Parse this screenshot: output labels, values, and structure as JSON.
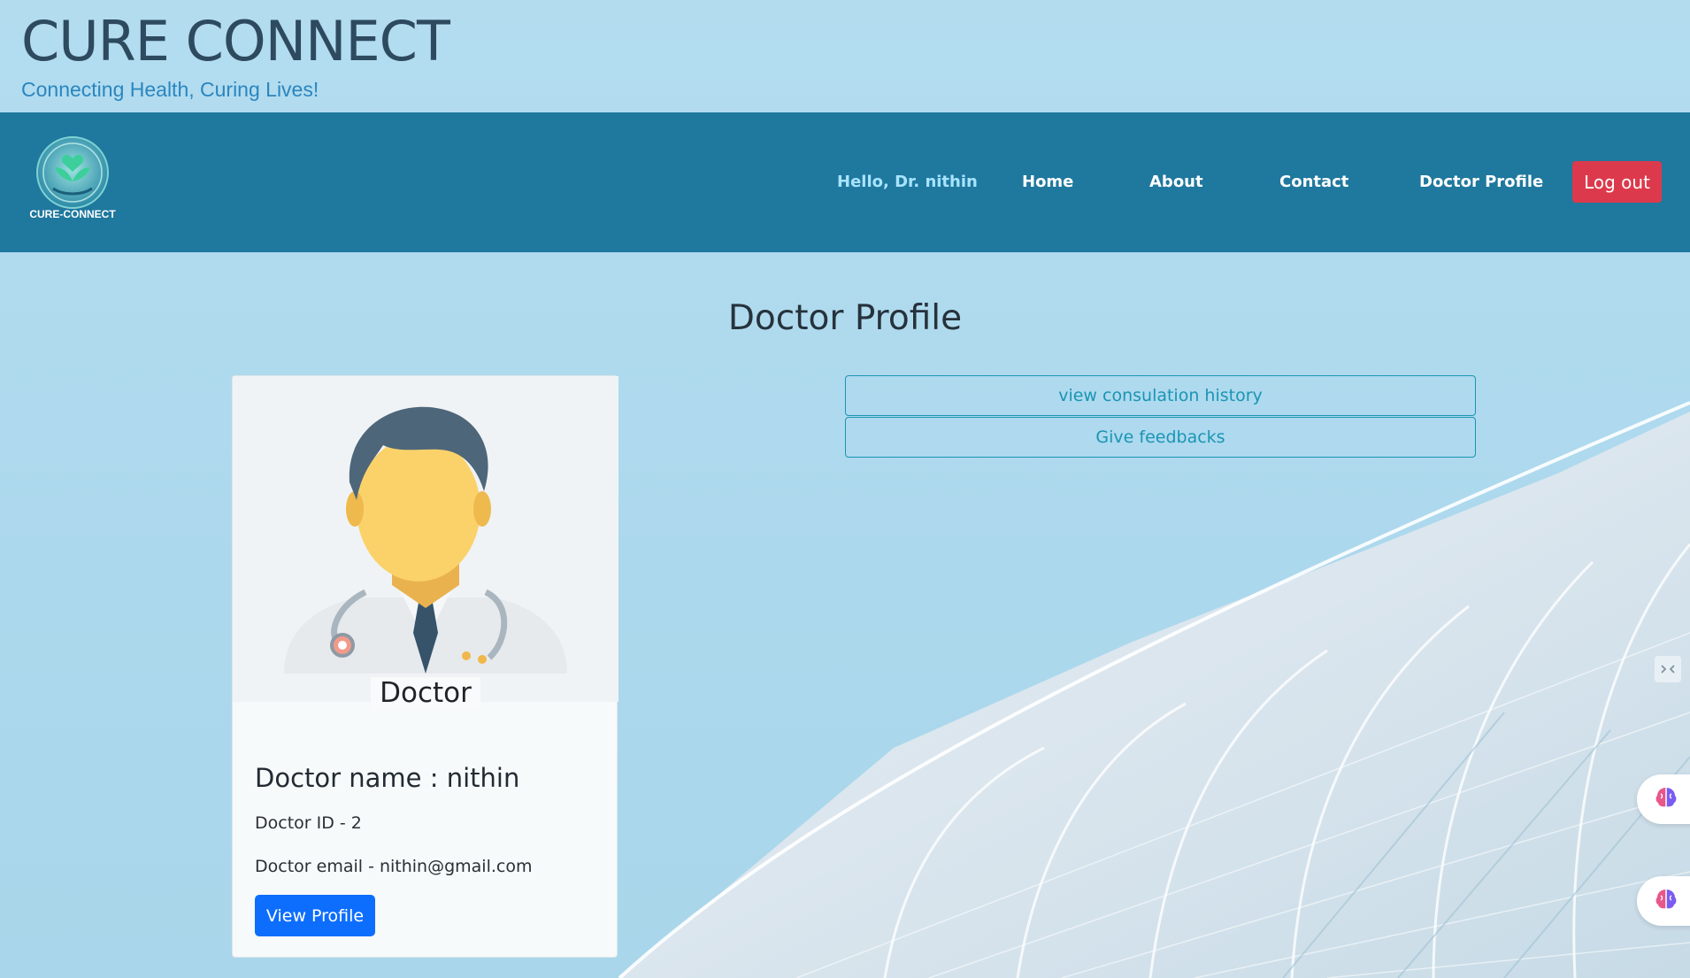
{
  "header": {
    "title": "CURE CONNECT",
    "tagline": "Connecting Health, Curing Lives!"
  },
  "navbar": {
    "logo_text": "CURE-CONNECT",
    "logo_icon": "lotus-heart-logo",
    "greeting": "Hello, Dr. nithin",
    "items": [
      {
        "label": "Home"
      },
      {
        "label": "About"
      },
      {
        "label": "Contact"
      },
      {
        "label": "Doctor Profile"
      }
    ],
    "logout_label": "Log out"
  },
  "main": {
    "page_title": "Doctor Profile",
    "card": {
      "image_icon": "doctor-avatar",
      "image_label": "Doctor",
      "name_line": "Doctor name : nithin",
      "id_line": "Doctor ID - 2",
      "email_line": "Doctor email - nithin@gmail.com",
      "view_profile_label": "View Profile"
    },
    "actions": [
      {
        "label": "view consulation history"
      },
      {
        "label": "Give feedbacks"
      }
    ]
  },
  "widgets": {
    "collapse_icon": "collapse-icon",
    "assistant_icon": "brain-icon"
  },
  "colors": {
    "navbar": "#1f789e",
    "logout": "#dc3a4c",
    "primary": "#0d6efd",
    "outline": "#1a95b4",
    "background": "#b3dcef"
  }
}
